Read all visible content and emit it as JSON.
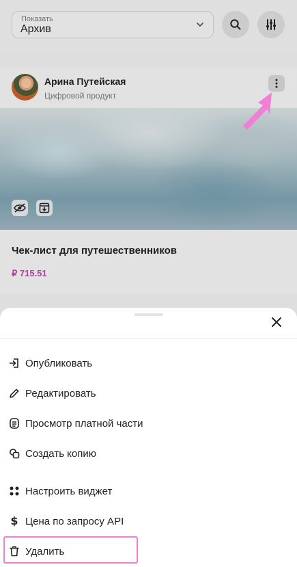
{
  "filter": {
    "label": "Показать",
    "value": "Архив"
  },
  "toolbar": {
    "search_icon": "search-icon",
    "filter_icon": "sliders-icon"
  },
  "product": {
    "author": "Арина Путейская",
    "type": "Цифровой продукт",
    "title": "Чек-лист для путешественников",
    "price": "₽ 715.51"
  },
  "sheet": {
    "items": [
      {
        "label": "Опубликовать",
        "icon": "publish-icon"
      },
      {
        "label": "Редактировать",
        "icon": "pencil-icon"
      },
      {
        "label": "Просмотр платной части",
        "icon": "document-icon"
      },
      {
        "label": "Создать копию",
        "icon": "copy-icon"
      },
      {
        "label": "Настроить виджет",
        "icon": "widget-icon"
      },
      {
        "label": "Цена по запросу API",
        "icon": "dollar-icon"
      },
      {
        "label": "Удалить",
        "icon": "trash-icon"
      }
    ]
  },
  "colors": {
    "accent": "#c63fb3",
    "annotation": "#f07fd6"
  }
}
